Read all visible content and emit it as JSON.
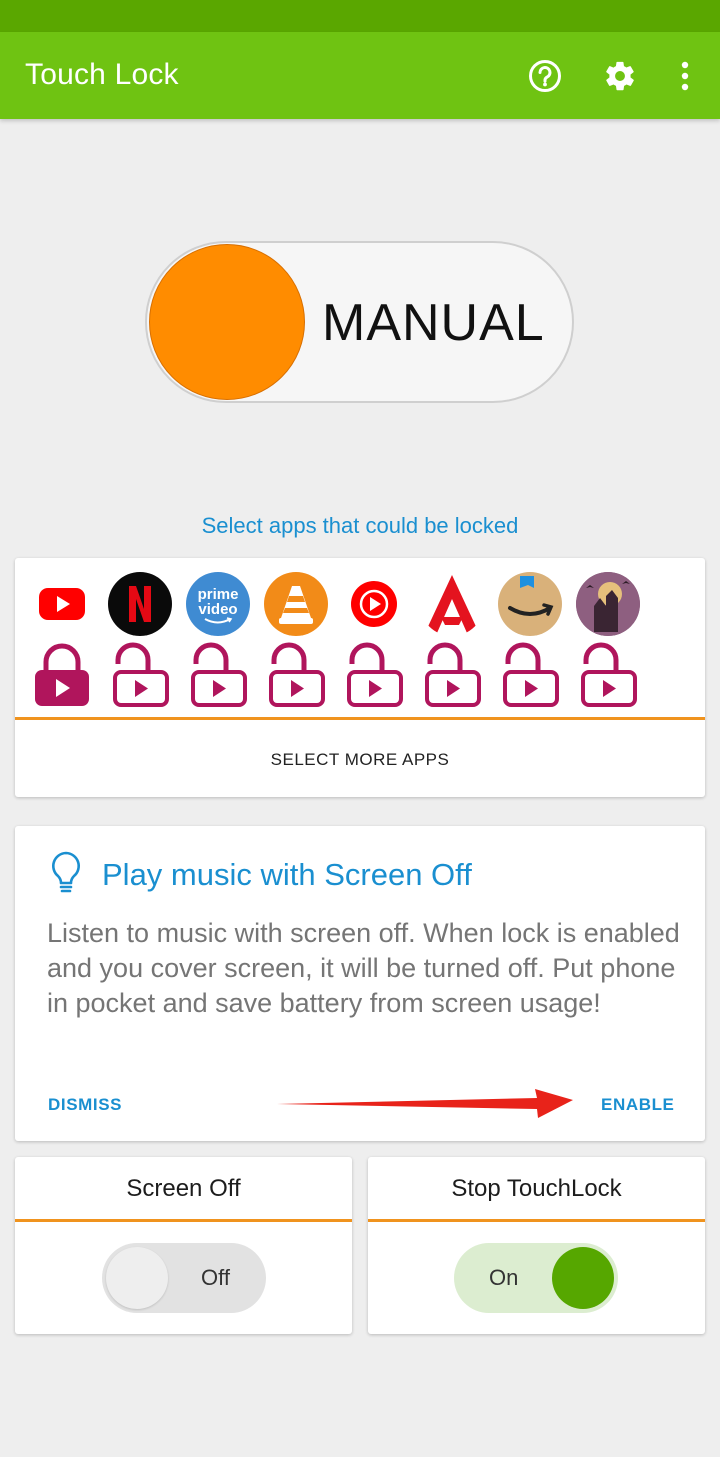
{
  "header": {
    "title": "Touch Lock",
    "icons": [
      "help-icon",
      "settings-icon",
      "more-vert-icon"
    ],
    "color": "#6fc312"
  },
  "mode_toggle": {
    "label": "MANUAL",
    "knob_color": "#ff8c00"
  },
  "apps_section": {
    "link": "Select apps that could be locked",
    "apps": [
      {
        "name": "YouTube",
        "icon": "youtube-icon",
        "locked": true
      },
      {
        "name": "Netflix",
        "icon": "netflix-icon",
        "locked": false
      },
      {
        "name": "Prime Video",
        "icon": "prime-video-icon",
        "icon_text_1": "prime",
        "icon_text_2": "video",
        "locked": false
      },
      {
        "name": "VLC",
        "icon": "vlc-icon",
        "locked": false
      },
      {
        "name": "YouTube Music",
        "icon": "youtube-music-icon",
        "locked": false
      },
      {
        "name": "Airtel",
        "icon": "airtel-icon",
        "locked": false
      },
      {
        "name": "Amazon",
        "icon": "amazon-icon",
        "locked": false
      },
      {
        "name": "Game",
        "icon": "game-icon",
        "locked": false
      }
    ],
    "select_more": "SELECT MORE APPS"
  },
  "tip_card": {
    "title": "Play music with Screen Off",
    "body": "Listen to music with screen off. When lock is enabled and you cover screen, it will be turned off. Put phone in pocket and save battery from screen usage!",
    "dismiss": "DISMISS",
    "enable": "ENABLE"
  },
  "screen_off": {
    "title": "Screen Off",
    "state": "Off",
    "on": false
  },
  "stop_touchlock": {
    "title": "Stop TouchLock",
    "state": "On",
    "on": true
  },
  "colors": {
    "accent_blue": "#1a8fd0",
    "divider_orange": "#f0931e",
    "lock_magenta": "#b0155c",
    "switch_on": "#56a700"
  }
}
